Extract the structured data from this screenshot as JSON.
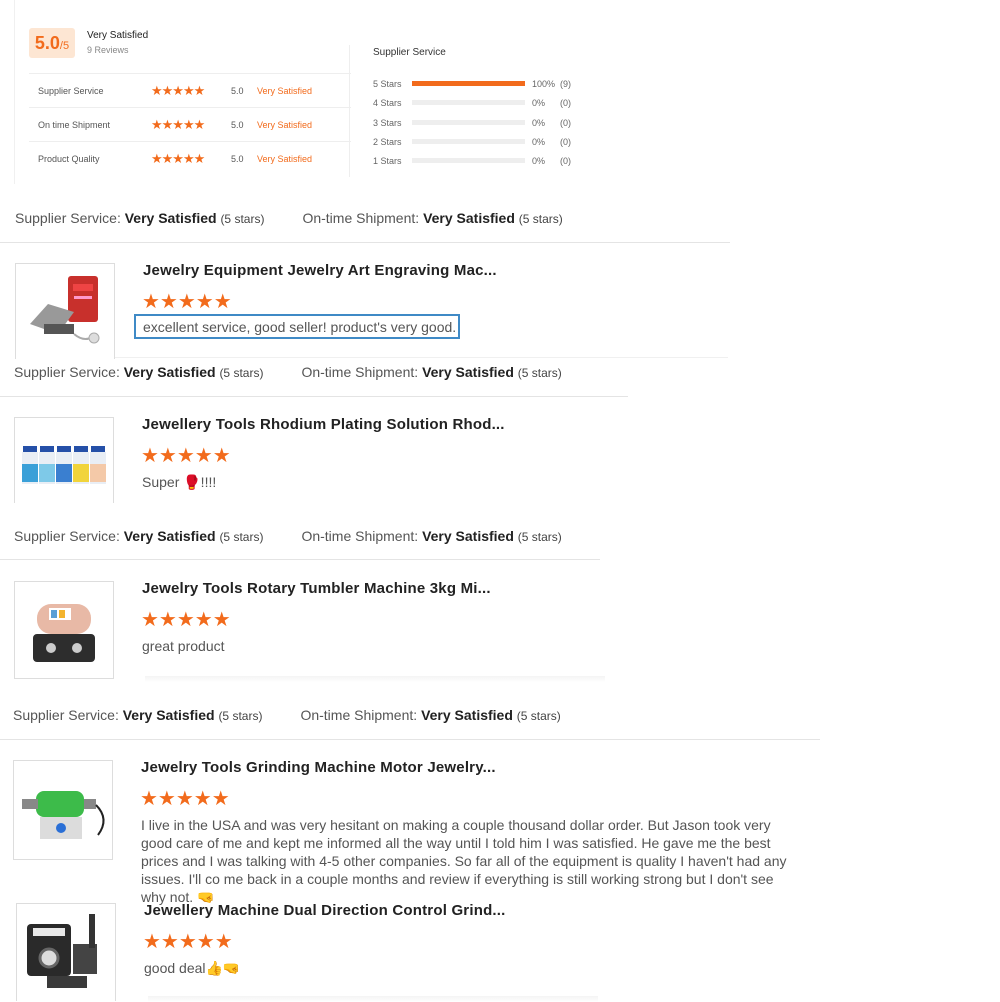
{
  "summary": {
    "score": "5.0",
    "score_max": "/5",
    "rating_label": "Very Satisfied",
    "review_count": "9 Reviews",
    "rows": [
      {
        "label": "Supplier Service",
        "stars": "★★★★★",
        "score": "5.0",
        "text": "Very Satisfied"
      },
      {
        "label": "On time Shipment",
        "stars": "★★★★★",
        "score": "5.0",
        "text": "Very Satisfied"
      },
      {
        "label": "Product Quality",
        "stars": "★★★★★",
        "score": "5.0",
        "text": "Very Satisfied"
      }
    ],
    "distribution_title": "Supplier Service",
    "distribution": [
      {
        "label": "5 Stars",
        "fraction": 1.0,
        "pct": "100%",
        "count": "(9)"
      },
      {
        "label": "4 Stars",
        "fraction": 0,
        "pct": "0%",
        "count": "(0)"
      },
      {
        "label": "3 Stars",
        "fraction": 0,
        "pct": "0%",
        "count": "(0)"
      },
      {
        "label": "2 Stars",
        "fraction": 0,
        "pct": "0%",
        "count": "(0)"
      },
      {
        "label": "1 Stars",
        "fraction": 0,
        "pct": "0%",
        "count": "(0)"
      }
    ]
  },
  "service_line": {
    "supplier_label": "Supplier Service:",
    "supplier_value": "Very Satisfied",
    "supplier_stars": "(5 stars)",
    "shipment_label": "On-time Shipment:",
    "shipment_value": "Very Satisfied",
    "shipment_stars": "(5 stars)"
  },
  "reviews": [
    {
      "title": "Jewelry Equipment Jewelry Art Engraving Mac...",
      "stars": "★★★★★",
      "text": "excellent service, good seller! product's very good."
    },
    {
      "title": "Jewellery Tools Rhodium Plating Solution Rhod...",
      "stars": "★★★★★",
      "text": "Super 🥊!!!!"
    },
    {
      "title": "Jewelry Tools Rotary Tumbler Machine 3kg Mi...",
      "stars": "★★★★★",
      "text": "great product"
    },
    {
      "title": "Jewelry Tools Grinding Machine Motor Jewelry...",
      "stars": "★★★★★",
      "text": "I live in the USA and was very hesitant on making a couple thousand dollar order. But Jason took very good care of me and kept me informed all the way until I told him I was satisfied. He gave me the best prices and I was talking with 4-5 other companies. So far all of the equipment is quality I haven't had any issues. I'll co me back in a couple months and review if everything is still working strong but I don't see why not. 🤜"
    },
    {
      "title": "Jewellery Machine Dual Direction Control Grind...",
      "stars": "★★★★★",
      "text": "good deal👍🤜"
    }
  ]
}
